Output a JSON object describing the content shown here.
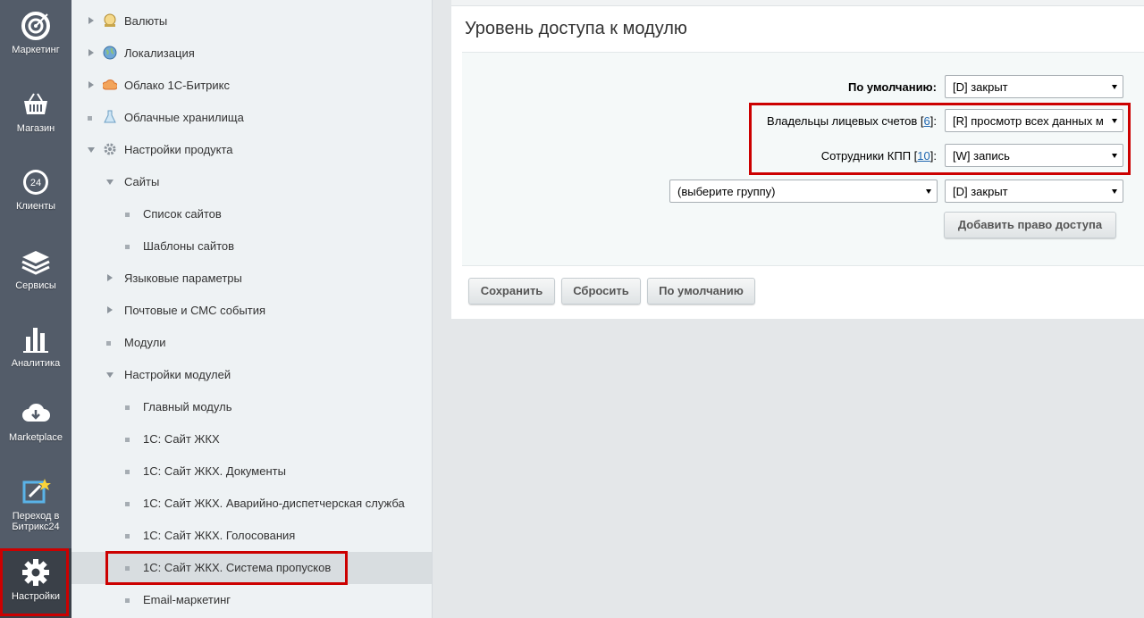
{
  "leftbar": {
    "items": [
      {
        "label": "Маркетинг",
        "icon": "target-icon"
      },
      {
        "label": "Магазин",
        "icon": "basket-icon"
      },
      {
        "label": "Клиенты",
        "icon": "clients-24-icon"
      },
      {
        "label": "Сервисы",
        "icon": "layers-icon"
      },
      {
        "label": "Аналитика",
        "icon": "bar-chart-icon"
      },
      {
        "label": "Marketplace",
        "icon": "cloud-download-icon"
      },
      {
        "label": "Переход в Битрикс24",
        "icon": "edit-star-icon"
      },
      {
        "label": "Настройки",
        "icon": "gear-icon"
      }
    ]
  },
  "tree": {
    "items": [
      {
        "label": "Валюты"
      },
      {
        "label": "Локализация"
      },
      {
        "label": "Облако 1С-Битрикс"
      },
      {
        "label": "Облачные хранилища"
      },
      {
        "label": "Настройки продукта"
      },
      {
        "label": "Сайты"
      },
      {
        "label": "Список сайтов"
      },
      {
        "label": "Шаблоны сайтов"
      },
      {
        "label": "Языковые параметры"
      },
      {
        "label": "Почтовые и СМС события"
      },
      {
        "label": "Модули"
      },
      {
        "label": "Настройки модулей"
      },
      {
        "label": "Главный модуль"
      },
      {
        "label": "1С: Сайт ЖКХ"
      },
      {
        "label": "1С: Сайт ЖКХ. Документы"
      },
      {
        "label": "1С: Сайт ЖКХ. Аварийно-диспетчерская служба"
      },
      {
        "label": "1С: Сайт ЖКХ. Голосования"
      },
      {
        "label": "1С: Сайт ЖКХ. Система пропусков"
      },
      {
        "label": "Email-маркетинг"
      }
    ]
  },
  "content": {
    "title": "Уровень доступа к модулю",
    "default_label": "По умолчанию:",
    "default_value": "[D] закрыт",
    "rows": [
      {
        "label": "Владельцы лицевых счетов",
        "count": "6",
        "value": "[R] просмотр всех данных м"
      },
      {
        "label": "Сотрудники КПП",
        "count": "10",
        "value": "[W] запись"
      }
    ],
    "group_select": "(выберите группу)",
    "group_value": "[D] закрыт",
    "add_button": "Добавить право доступа",
    "buttons": {
      "save": "Сохранить",
      "reset": "Сбросить",
      "default": "По умолчанию"
    }
  },
  "colors": {
    "leftbar": "#535c69",
    "highlight": "#cc0000",
    "link": "#2067b0"
  }
}
